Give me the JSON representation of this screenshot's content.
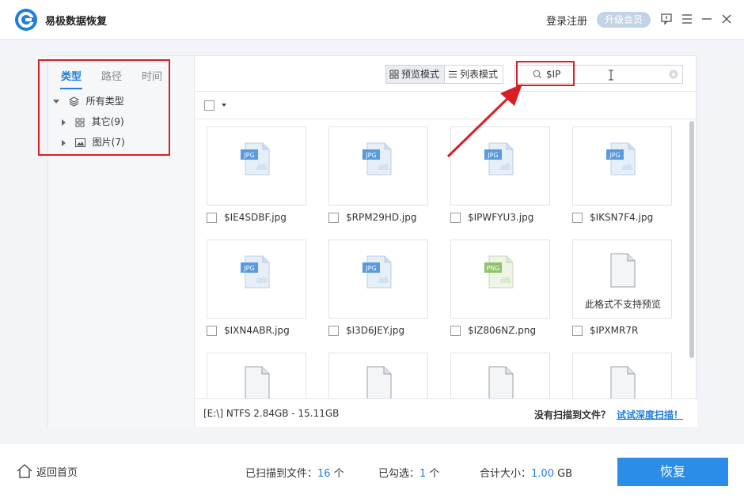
{
  "app": {
    "title": "易极数据恢复"
  },
  "titlebar": {
    "login": "登录注册",
    "vip": "升级会员"
  },
  "colors": {
    "accent": "#1f7ee0",
    "button": "#2b8de8",
    "highlight": "#d81f26"
  },
  "left": {
    "tabs": [
      {
        "label": "类型",
        "active": true
      },
      {
        "label": "路径",
        "active": false
      },
      {
        "label": "时间",
        "active": false
      }
    ],
    "tree": {
      "root": "所有类型",
      "items": [
        {
          "label": "其它(9)",
          "icon": "grid-icon"
        },
        {
          "label": "图片(7)",
          "icon": "image-icon"
        }
      ]
    }
  },
  "toolbar": {
    "preview_mode": "预览模式",
    "list_mode": "列表模式"
  },
  "search": {
    "value": "$IP"
  },
  "files": [
    {
      "name": "$IE4SDBF.jpg",
      "type": "JPG"
    },
    {
      "name": "$RPM29HD.jpg",
      "type": "JPG"
    },
    {
      "name": "$IPWFYU3.jpg",
      "type": "JPG"
    },
    {
      "name": "$IKSN7F4.jpg",
      "type": "JPG"
    },
    {
      "name": "$IXN4ABR.jpg",
      "type": "JPG"
    },
    {
      "name": "$I3D6JEY.jpg",
      "type": "JPG"
    },
    {
      "name": "$IZ806NZ.png",
      "type": "PNG"
    },
    {
      "name": "$IPXMR7R",
      "type": "",
      "caption": "此格式不支持预览"
    },
    {
      "name": "",
      "type": ""
    },
    {
      "name": "",
      "type": ""
    },
    {
      "name": "",
      "type": ""
    },
    {
      "name": "",
      "type": ""
    }
  ],
  "status": {
    "disk": "[E:\\] NTFS 2.84GB - 15.11GB",
    "no_file": "没有扫描到文件？",
    "deep_scan": "试试深度扫描！"
  },
  "footer": {
    "home": "返回首页",
    "scanned_label": "已扫描到文件：",
    "scanned_value": "16",
    "scanned_unit": " 个",
    "checked_label": "已勾选：",
    "checked_value": "1",
    "checked_unit": " 个",
    "size_label": "合计大小：",
    "size_value": "1.00",
    "size_unit": " GB",
    "recover": "恢复"
  }
}
